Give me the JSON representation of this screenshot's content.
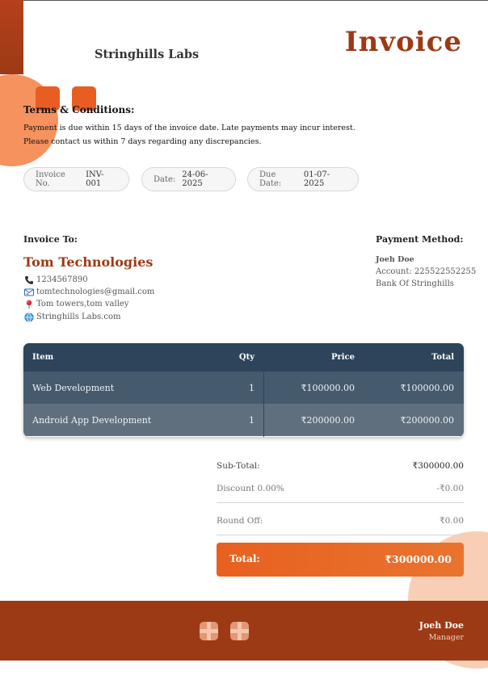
{
  "header": {
    "company_name": "Stringhills Labs",
    "document_title": "Invoice"
  },
  "terms": {
    "title": "Terms & Conditions:",
    "lines": [
      "Payment is due within 15 days of the invoice date. Late payments may incur interest.",
      "Please contact us within 7 days regarding any discrepancies."
    ]
  },
  "meta": {
    "invoice_no_label": "Invoice No.",
    "invoice_no": "INV-001",
    "date_label": "Date:",
    "date": "24-06-2025",
    "due_date_label": "Due Date:",
    "due_date": "01-07-2025"
  },
  "bill_to": {
    "label": "Invoice To:",
    "name": "Tom Technologies",
    "phone": "1234567890",
    "email": "tomtechnologies@gmail.com",
    "address": "Tom towers,tom valley",
    "website": "Stringhills Labs.com"
  },
  "payment": {
    "label": "Payment Method:",
    "name": "Joeh Doe",
    "account": "Account: 225522552255",
    "bank": "Bank Of Stringhills"
  },
  "table": {
    "headers": {
      "item": "Item",
      "qty": "Qty",
      "price": "Price",
      "total": "Total"
    },
    "rows": [
      {
        "item": "Web Development",
        "qty": "1",
        "price": "₹100000.00",
        "total": "₹100000.00"
      },
      {
        "item": "Android App Development",
        "qty": "1",
        "price": "₹200000.00",
        "total": "₹200000.00"
      }
    ]
  },
  "summary": {
    "subtotal_label": "Sub-Total:",
    "subtotal": "₹300000.00",
    "discount_label": "Discount 0.00%",
    "discount": "-₹0.00",
    "roundoff_label": "Round Off:",
    "roundoff": "₹0.00",
    "total_label": "Total:",
    "total": "₹300000.00"
  },
  "footer": {
    "signatory": "Joeh Doe",
    "role": "Manager"
  },
  "colors": {
    "brand": "#9c3a15",
    "accent": "#e8601f",
    "table_header": "#2d445a"
  },
  "icons": {
    "phone": "phone-icon",
    "email": "email-icon",
    "address": "pin-icon",
    "website": "globe-icon"
  }
}
